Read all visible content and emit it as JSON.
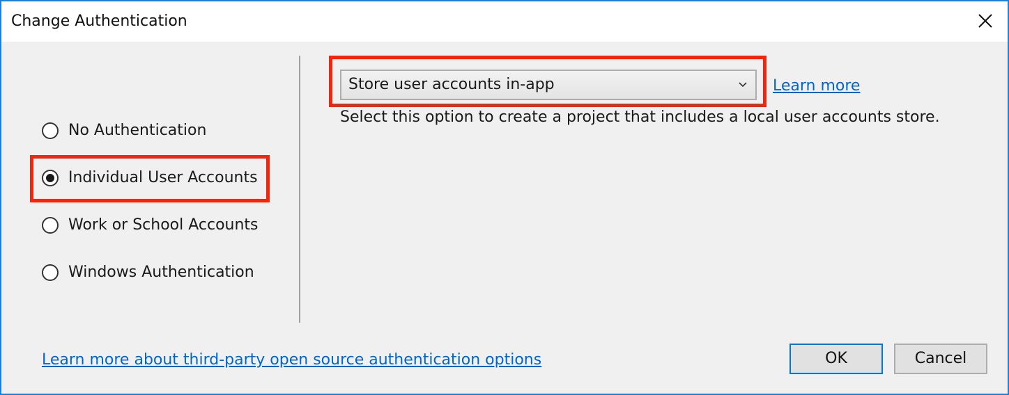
{
  "window": {
    "title": "Change Authentication"
  },
  "auth_options": [
    {
      "label": "No Authentication",
      "selected": false
    },
    {
      "label": "Individual User Accounts",
      "selected": true
    },
    {
      "label": "Work or School Accounts",
      "selected": false
    },
    {
      "label": "Windows Authentication",
      "selected": false
    }
  ],
  "account_store": {
    "selected_value": "Store user accounts in-app",
    "learn_more_label": "Learn more",
    "description": "Select this option to create a project that includes a local user accounts store."
  },
  "footer": {
    "third_party_link": "Learn more about third-party open source authentication options",
    "ok_label": "OK",
    "cancel_label": "Cancel"
  },
  "icons": {
    "close": "close-icon",
    "dropdown": "chevron-down-icon"
  },
  "colors": {
    "highlight": "#f0260f",
    "link": "#0066cc",
    "window_border": "#1e7fd8"
  }
}
